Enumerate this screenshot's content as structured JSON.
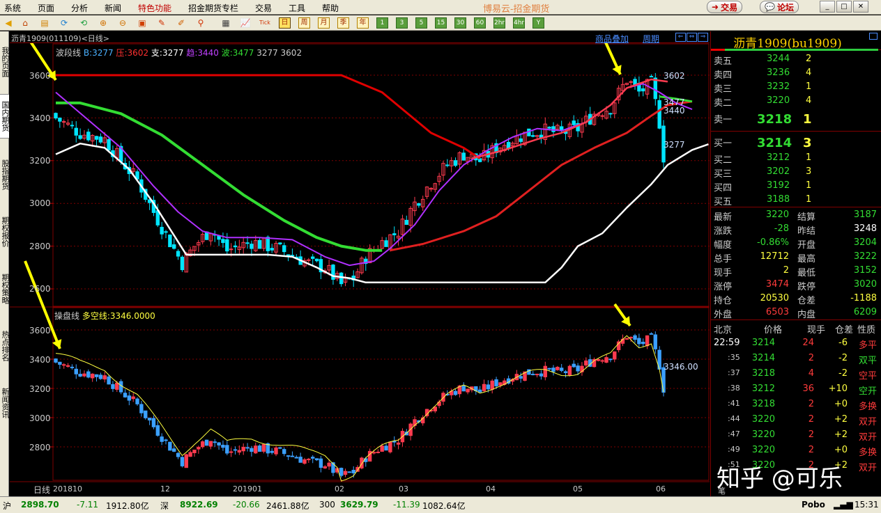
{
  "menu": {
    "items": [
      "系统",
      "页面",
      "分析",
      "新闻",
      "特色功能",
      "招金期货专栏",
      "交易",
      "工具",
      "帮助"
    ],
    "app_title": "博易云-招金期货",
    "trade_button": "交易",
    "forum_button": "论坛"
  },
  "toolbar": {
    "periods": [
      "日",
      "周",
      "月",
      "季",
      "年"
    ],
    "minutes": [
      "1",
      "3",
      "5",
      "15",
      "30",
      "60",
      "2hr",
      "4hr",
      "Y"
    ]
  },
  "left_tabs": [
    "我的页面",
    "国内期货",
    "股指期货",
    "期权报价",
    "期权策略",
    "热点排名",
    "新闻资讯"
  ],
  "chart": {
    "symbol_label": "沥青1909(011109)<日线>",
    "overlay_link": "商品叠加",
    "cycle_link": "周期",
    "main_indicator": {
      "name": "波段线",
      "b_label": "B:3277",
      "ya_label": "压:3602",
      "zhi_label": "支:3277",
      "qu_label": "趋:3440",
      "bo_label": "波:3477",
      "extra": "3277 3602",
      "right_tags": [
        "3602",
        "3477",
        "3440",
        "3277"
      ]
    },
    "sub_indicator": {
      "name": "操盘线",
      "dk_label": "多空线:3346.0000",
      "right_tag": "3346.00"
    },
    "y_axis_main": [
      "3600",
      "3400",
      "3200",
      "3000",
      "2800",
      "2600"
    ],
    "y_axis_sub": [
      "3600",
      "3400",
      "3200",
      "3000",
      "2800"
    ],
    "x_axis": [
      "日线",
      "201810",
      "12",
      "201901",
      "02",
      "03",
      "04",
      "05",
      "06"
    ],
    "colors": {
      "up": "#ff3b4f",
      "down": "#00e5ff",
      "resistance": "#e00000",
      "trend": "#b030ff",
      "wave": "#33dd33",
      "support": "#ffffff",
      "ma_red": "#e02020",
      "yellow": "#ffff40",
      "sub_up": "#ff3b4f",
      "sub_down": "#3ba0ff"
    }
  },
  "quote": {
    "title": "沥青1909(bu1909)",
    "asks": [
      {
        "label": "卖五",
        "price": "3244",
        "vol": "2"
      },
      {
        "label": "卖四",
        "price": "3236",
        "vol": "4"
      },
      {
        "label": "卖三",
        "price": "3232",
        "vol": "1"
      },
      {
        "label": "卖二",
        "price": "3220",
        "vol": "4"
      },
      {
        "label": "卖一",
        "price": "3218",
        "vol": "1"
      }
    ],
    "bids": [
      {
        "label": "买一",
        "price": "3214",
        "vol": "3"
      },
      {
        "label": "买二",
        "price": "3212",
        "vol": "1"
      },
      {
        "label": "买三",
        "price": "3202",
        "vol": "3"
      },
      {
        "label": "买四",
        "price": "3192",
        "vol": "1"
      },
      {
        "label": "买五",
        "price": "3188",
        "vol": "1"
      }
    ],
    "stats": [
      {
        "l1": "最新",
        "v1": "3220",
        "c1": "#33dd33",
        "l2": "结算",
        "v2": "3187",
        "c2": "#33dd33"
      },
      {
        "l1": "涨跌",
        "v1": "-28",
        "c1": "#33dd33",
        "l2": "昨结",
        "v2": "3248",
        "c2": "#ffffff"
      },
      {
        "l1": "幅度",
        "v1": "-0.86%",
        "c1": "#33dd33",
        "l2": "开盘",
        "v2": "3204",
        "c2": "#33dd33"
      },
      {
        "l1": "总手",
        "v1": "12712",
        "c1": "#ffff40",
        "l2": "最高",
        "v2": "3222",
        "c2": "#33dd33"
      },
      {
        "l1": "现手",
        "v1": "2",
        "c1": "#ffff40",
        "l2": "最低",
        "v2": "3152",
        "c2": "#33dd33"
      },
      {
        "l1": "涨停",
        "v1": "3474",
        "c1": "#ff3b3b",
        "l2": "跌停",
        "v2": "3020",
        "c2": "#33dd33"
      },
      {
        "l1": "持仓",
        "v1": "20530",
        "c1": "#ffff40",
        "l2": "仓差",
        "v2": "-1188",
        "c2": "#ffff40"
      },
      {
        "l1": "外盘",
        "v1": "6503",
        "c1": "#ff3b3b",
        "l2": "内盘",
        "v2": "6209",
        "c2": "#33dd33"
      }
    ],
    "tick_header": [
      "北京",
      "价格",
      "现手",
      "仓差",
      "性质"
    ],
    "ticks": [
      {
        "time": "22:59",
        "price": "3214",
        "vol": "24",
        "oi": "-6",
        "type": "多平",
        "tc": "#ff3b3b"
      },
      {
        "time": ":35",
        "price": "3214",
        "vol": "2",
        "oi": "-2",
        "type": "双平",
        "tc": "#33dd33"
      },
      {
        "time": ":37",
        "price": "3218",
        "vol": "4",
        "oi": "-2",
        "type": "空平",
        "tc": "#ff3b3b"
      },
      {
        "time": ":38",
        "price": "3212",
        "vol": "36",
        "oi": "+10",
        "type": "空开",
        "tc": "#33dd33"
      },
      {
        "time": ":41",
        "price": "3218",
        "vol": "2",
        "oi": "+0",
        "type": "多换",
        "tc": "#ff3b3b"
      },
      {
        "time": ":44",
        "price": "3220",
        "vol": "2",
        "oi": "+2",
        "type": "双开",
        "tc": "#ff3b3b"
      },
      {
        "time": ":47",
        "price": "3220",
        "vol": "2",
        "oi": "+2",
        "type": "双开",
        "tc": "#ff3b3b"
      },
      {
        "time": ":49",
        "price": "3220",
        "vol": "2",
        "oi": "+0",
        "type": "多换",
        "tc": "#ff3b3b"
      },
      {
        "time": ":51",
        "price": "3220",
        "vol": "2",
        "oi": "+2",
        "type": "双开",
        "tc": "#ff3b3b"
      }
    ]
  },
  "status": {
    "sh_label": "沪",
    "sh_value": "2898.70",
    "sh_change": "-7.11",
    "sh_amount": "1912.80亿",
    "sz_label": "深",
    "sz_value": "8922.69",
    "sz_change": "-20.66",
    "sz_amount": "2461.88亿",
    "hs_label": "300",
    "hs_value": "3629.79",
    "hs_change": "-11.39",
    "hs_amount": "1082.64亿",
    "brand": "Pobo",
    "time": "15:31"
  },
  "watermark": "知乎 @可乐"
}
